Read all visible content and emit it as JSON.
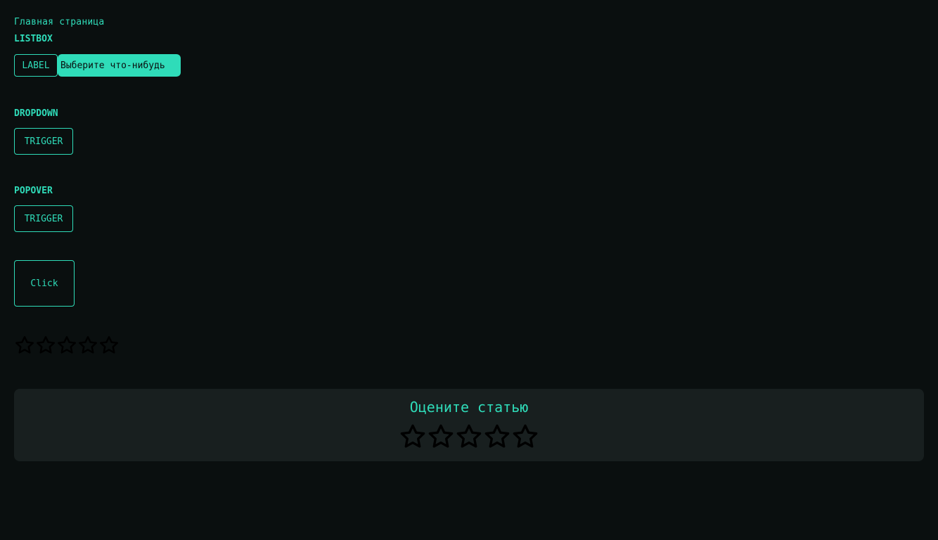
{
  "breadcrumb": "Главная страница",
  "listbox": {
    "title": "LISTBOX",
    "label": "LABEL",
    "placeholder": "Выберите что-нибудь"
  },
  "dropdown": {
    "title": "DROPDOWN",
    "trigger_label": "TRIGGER"
  },
  "popover": {
    "title": "POPOVER",
    "trigger_label": "TRIGGER"
  },
  "click_button": {
    "label": "Click"
  },
  "small_rating": {
    "icon": "star-outline-icon",
    "max_stars": 5,
    "value": 0
  },
  "article_rating": {
    "title": "Оцените статью",
    "icon": "star-outline-icon",
    "max_stars": 5,
    "value": 0
  },
  "colors": {
    "background": "#0a0f0f",
    "accent": "#2fdcb9",
    "card": "#181f1f",
    "star_stroke": "#000000"
  }
}
